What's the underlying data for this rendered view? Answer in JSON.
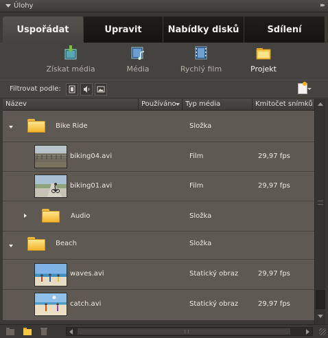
{
  "panel": {
    "title": "Úlohy",
    "menu_glyph": "▸▸"
  },
  "tabs": [
    {
      "label": "Uspořádat",
      "active": true
    },
    {
      "label": "Upravit",
      "active": false
    },
    {
      "label": "Nabídky disků",
      "active": false
    },
    {
      "label": "Sdílení",
      "active": false
    }
  ],
  "toolbar": {
    "items": [
      {
        "label": "Získat média",
        "icon": "get-media-icon"
      },
      {
        "label": "Média",
        "icon": "media-icon"
      },
      {
        "label": "Rychlý film",
        "icon": "instant-movie-icon"
      },
      {
        "label": "Projekt",
        "icon": "project-folder-icon",
        "active": true
      }
    ]
  },
  "filter": {
    "label": "Filtrovat podle:",
    "buttons": [
      "video-filter-icon",
      "audio-filter-icon",
      "image-filter-icon"
    ],
    "new_item_icon": "new-item-icon"
  },
  "columns": [
    "Název",
    "Používáno",
    "Typ média",
    "Kmitočet snímků"
  ],
  "rows": [
    {
      "kind": "folder",
      "expanded": true,
      "name": "Bike Ride",
      "type": "Složka",
      "rate": ""
    },
    {
      "kind": "clip",
      "name": "biking04.avi",
      "type": "Film",
      "rate": "29,97 fps",
      "thumb": "track"
    },
    {
      "kind": "clip",
      "name": "biking01.avi",
      "type": "Film",
      "rate": "29,97 fps",
      "thumb": "road"
    },
    {
      "kind": "folder",
      "expanded": false,
      "name": "Audio",
      "type": "Složka",
      "rate": ""
    },
    {
      "kind": "folder",
      "expanded": true,
      "name": "Beach",
      "type": "Složka",
      "rate": ""
    },
    {
      "kind": "clip",
      "name": "waves.avi",
      "type": "Statický obraz",
      "rate": "29,97 fps",
      "thumb": "beach1"
    },
    {
      "kind": "clip",
      "name": "catch.avi",
      "type": "Statický obraz",
      "rate": "29,97 fps",
      "thumb": "beach2"
    }
  ],
  "colors": {
    "background": "#3b3934",
    "active_tab": "#55534e",
    "list_bg": "#5e5a53",
    "folder": "#f1b52c"
  }
}
